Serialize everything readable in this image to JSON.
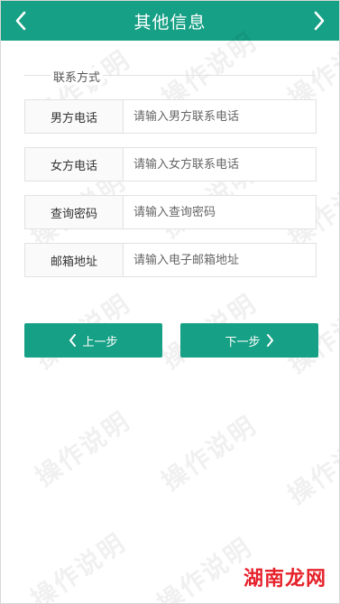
{
  "header": {
    "title": "其他信息",
    "back_icon": "chevron-left-icon",
    "forward_icon": "chevron-right-icon"
  },
  "section": {
    "legend": "联系方式"
  },
  "fields": [
    {
      "label": "男方电话",
      "placeholder": "请输入男方联系电话"
    },
    {
      "label": "女方电话",
      "placeholder": "请输入女方联系电话"
    },
    {
      "label": "查询密码",
      "placeholder": "请输入查询密码"
    },
    {
      "label": "邮箱地址",
      "placeholder": "请输入电子邮箱地址"
    }
  ],
  "buttons": {
    "prev": "上一步",
    "next": "下一步"
  },
  "watermark": "操作说明",
  "brand": {
    "part1": "湖南",
    "part2": "龙网"
  },
  "colors": {
    "accent": "#16a085"
  }
}
